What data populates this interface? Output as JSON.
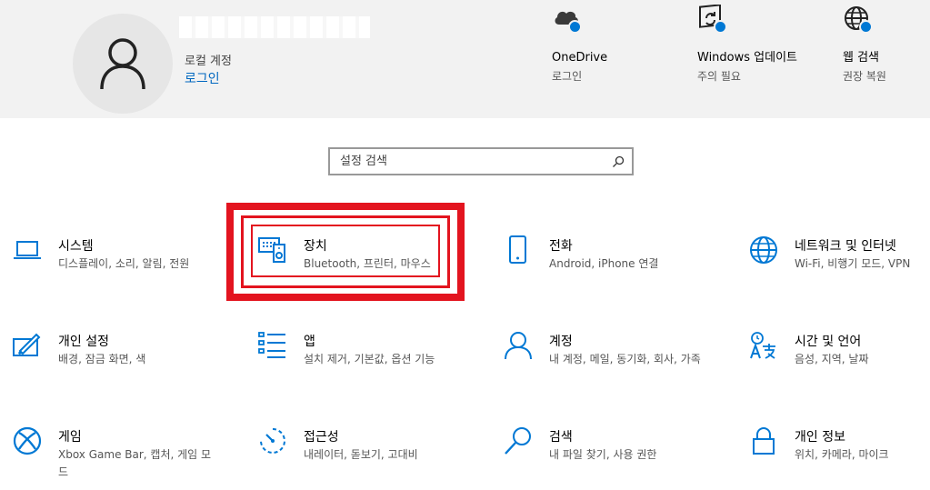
{
  "header": {
    "account_type": "로컬 계정",
    "signin_link": "로그인",
    "items": [
      {
        "name": "onedrive",
        "icon": "cloud-icon",
        "title": "OneDrive",
        "sub": "로그인"
      },
      {
        "name": "windows-update",
        "icon": "windows-update-icon",
        "title": "Windows 업데이트",
        "sub": "주의 필요"
      },
      {
        "name": "web-search",
        "icon": "globe-icon",
        "title": "웹 검색",
        "sub": "권장 복원"
      }
    ]
  },
  "search": {
    "placeholder": "설정 검색"
  },
  "categories": [
    {
      "icon": "laptop-icon",
      "title": "시스템",
      "desc": "디스플레이, 소리, 알림, 전원"
    },
    {
      "icon": "devices-icon",
      "title": "장치",
      "desc": "Bluetooth, 프린터, 마우스"
    },
    {
      "icon": "phone-icon",
      "title": "전화",
      "desc": "Android, iPhone 연결"
    },
    {
      "icon": "globe-icon",
      "title": "네트워크 및 인터넷",
      "desc": "Wi-Fi, 비행기 모드, VPN"
    },
    {
      "icon": "personalization-icon",
      "title": "개인 설정",
      "desc": "배경, 잠금 화면, 색"
    },
    {
      "icon": "apps-list-icon",
      "title": "앱",
      "desc": "설치 제거, 기본값, 옵션 기능"
    },
    {
      "icon": "person-icon",
      "title": "계정",
      "desc": "내 계정, 메일, 동기화, 회사, 가족"
    },
    {
      "icon": "language-icon",
      "title": "시간 및 언어",
      "desc": "음성, 지역, 날짜"
    },
    {
      "icon": "xbox-icon",
      "title": "게임",
      "desc": "Xbox Game Bar, 캡처, 게임 모드"
    },
    {
      "icon": "accessibility-timer-icon",
      "title": "접근성",
      "desc": "내레이터, 돋보기, 고대비"
    },
    {
      "icon": "search-magnifier-icon",
      "title": "검색",
      "desc": "내 파일 찾기, 사용 권한"
    },
    {
      "icon": "lock-icon",
      "title": "개인 정보",
      "desc": "위치, 카메라, 마이크"
    }
  ],
  "colors": {
    "accent": "#0078d4",
    "link": "#0067c0",
    "highlight": "#e3141f",
    "header_bg": "#f2f2f2"
  }
}
